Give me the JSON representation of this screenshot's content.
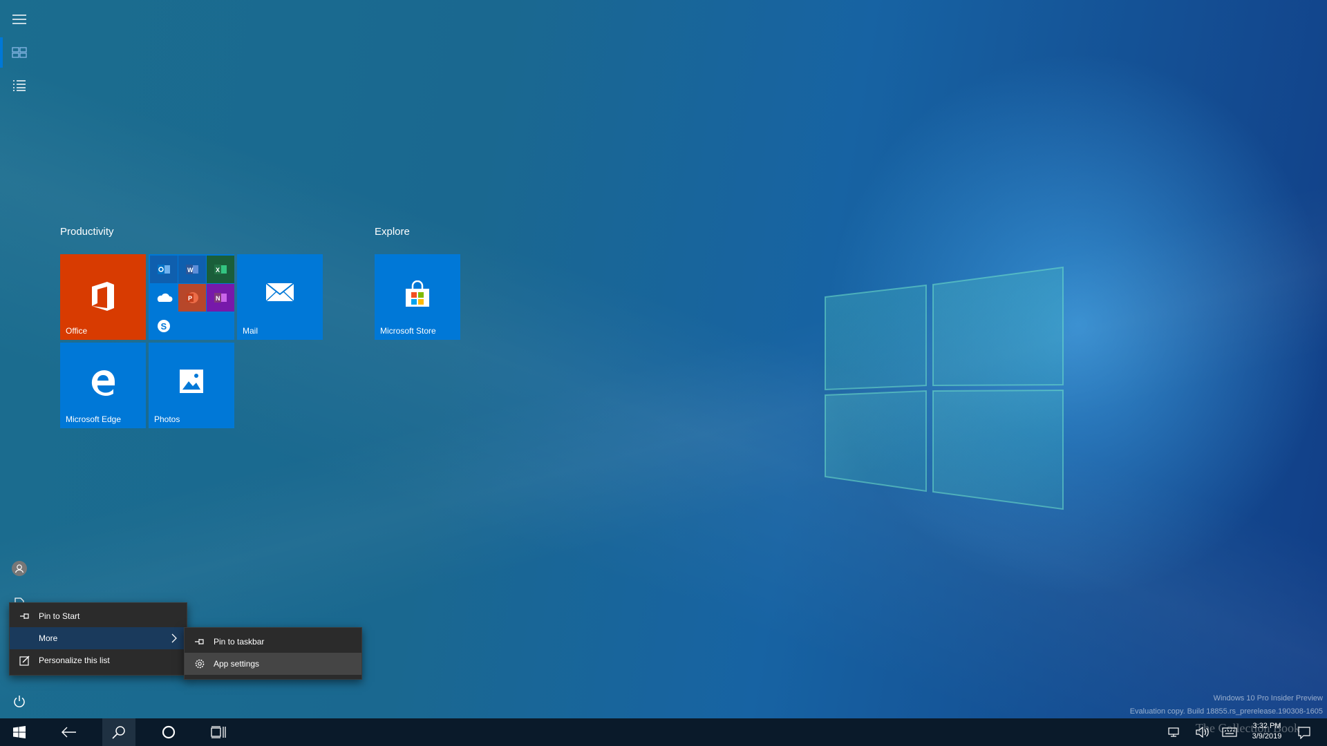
{
  "start": {
    "groups": [
      {
        "title": "Productivity",
        "tiles": [
          {
            "label": "Office",
            "color": "#d83b01",
            "icon": "office-icon"
          },
          {
            "label": "",
            "color": "#0078d7",
            "icon": "office-apps-folder-icon",
            "apps": [
              "outlook-icon",
              "word-icon",
              "excel-icon",
              "onedrive-icon",
              "powerpoint-icon",
              "onenote-icon",
              "skype-icon"
            ]
          },
          {
            "label": "Mail",
            "color": "#0078d7",
            "icon": "mail-icon"
          },
          {
            "label": "Microsoft Edge",
            "color": "#0078d7",
            "icon": "edge-icon"
          },
          {
            "label": "Photos",
            "color": "#0078d7",
            "icon": "photos-icon"
          }
        ]
      },
      {
        "title": "Explore",
        "tiles": [
          {
            "label": "Microsoft Store",
            "color": "#0078d7",
            "icon": "store-icon"
          }
        ]
      }
    ]
  },
  "context_menu": {
    "items": [
      {
        "label": "Pin to Start",
        "icon": "pin-icon"
      },
      {
        "label": "More",
        "icon": "",
        "submenu": true
      },
      {
        "label": "Personalize this list",
        "icon": "personalize-icon"
      }
    ]
  },
  "submenu": {
    "items": [
      {
        "label": "Pin to taskbar",
        "icon": "pin-icon"
      },
      {
        "label": "App settings",
        "icon": "gear-icon"
      }
    ]
  },
  "taskbar": {
    "time": "3:32 PM",
    "date": "3/9/2019"
  },
  "watermark": {
    "line1": "Windows 10 Pro Insider Preview",
    "line2": "Evaluation copy. Build 18855.rs_prerelease.190308-1605",
    "overlay": "The Collection Book"
  },
  "colors": {
    "accent": "#0078d7",
    "office": "#d83b01",
    "menu_bg": "#2b2b2b",
    "taskbar_bg": "#0a1a2a"
  }
}
